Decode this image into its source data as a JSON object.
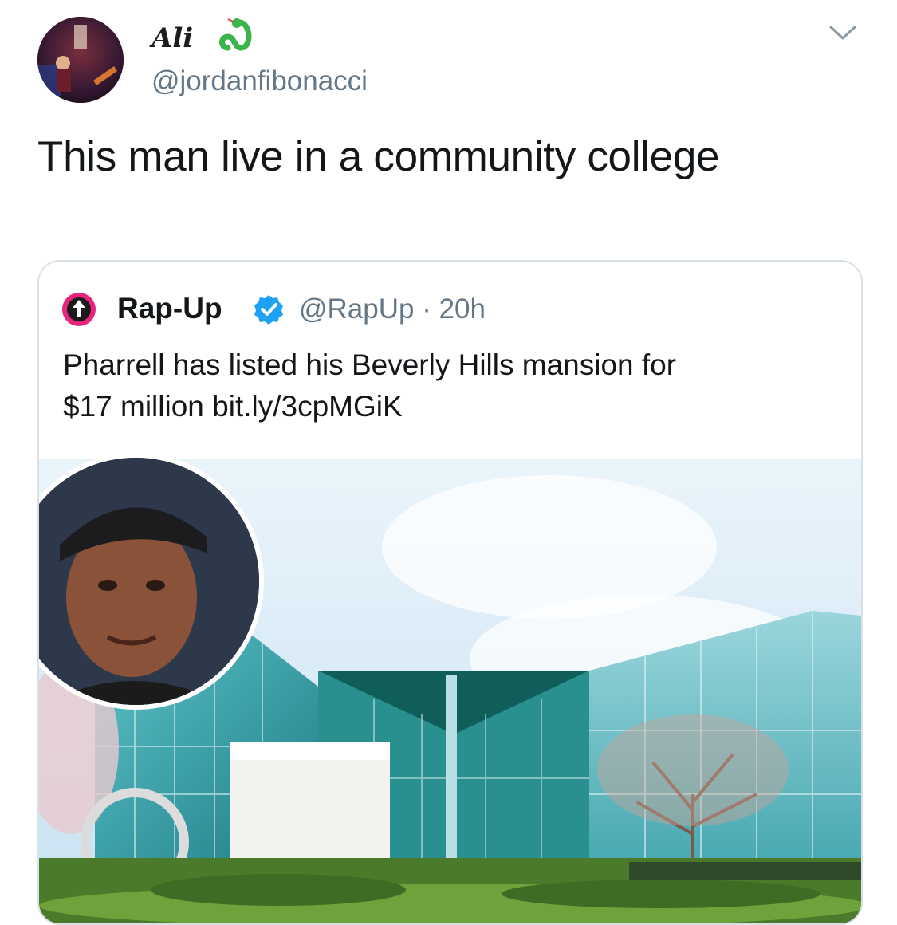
{
  "tweet": {
    "display_name": "Ali",
    "handle": "@jordanfibonacci",
    "text": "This man live in a community college",
    "icons": {
      "badge": "snake-icon",
      "menu": "chevron-down-icon"
    }
  },
  "quoted_tweet": {
    "display_name": "Rap-Up",
    "meta": "@RapUp · 20h",
    "text_line1": "Pharrell has listed his Beverly Hills mansion for",
    "text_line2": "$17 million bit.ly/3cpMGiK",
    "icons": {
      "avatar": "rapup-logo-icon",
      "verified": "verified-badge-icon"
    }
  },
  "colors": {
    "text": "#14171a",
    "secondary": "#657786",
    "verified_blue": "#1da1f2",
    "snake_green": "#3bb44a",
    "card_border": "#d9e1e8"
  }
}
